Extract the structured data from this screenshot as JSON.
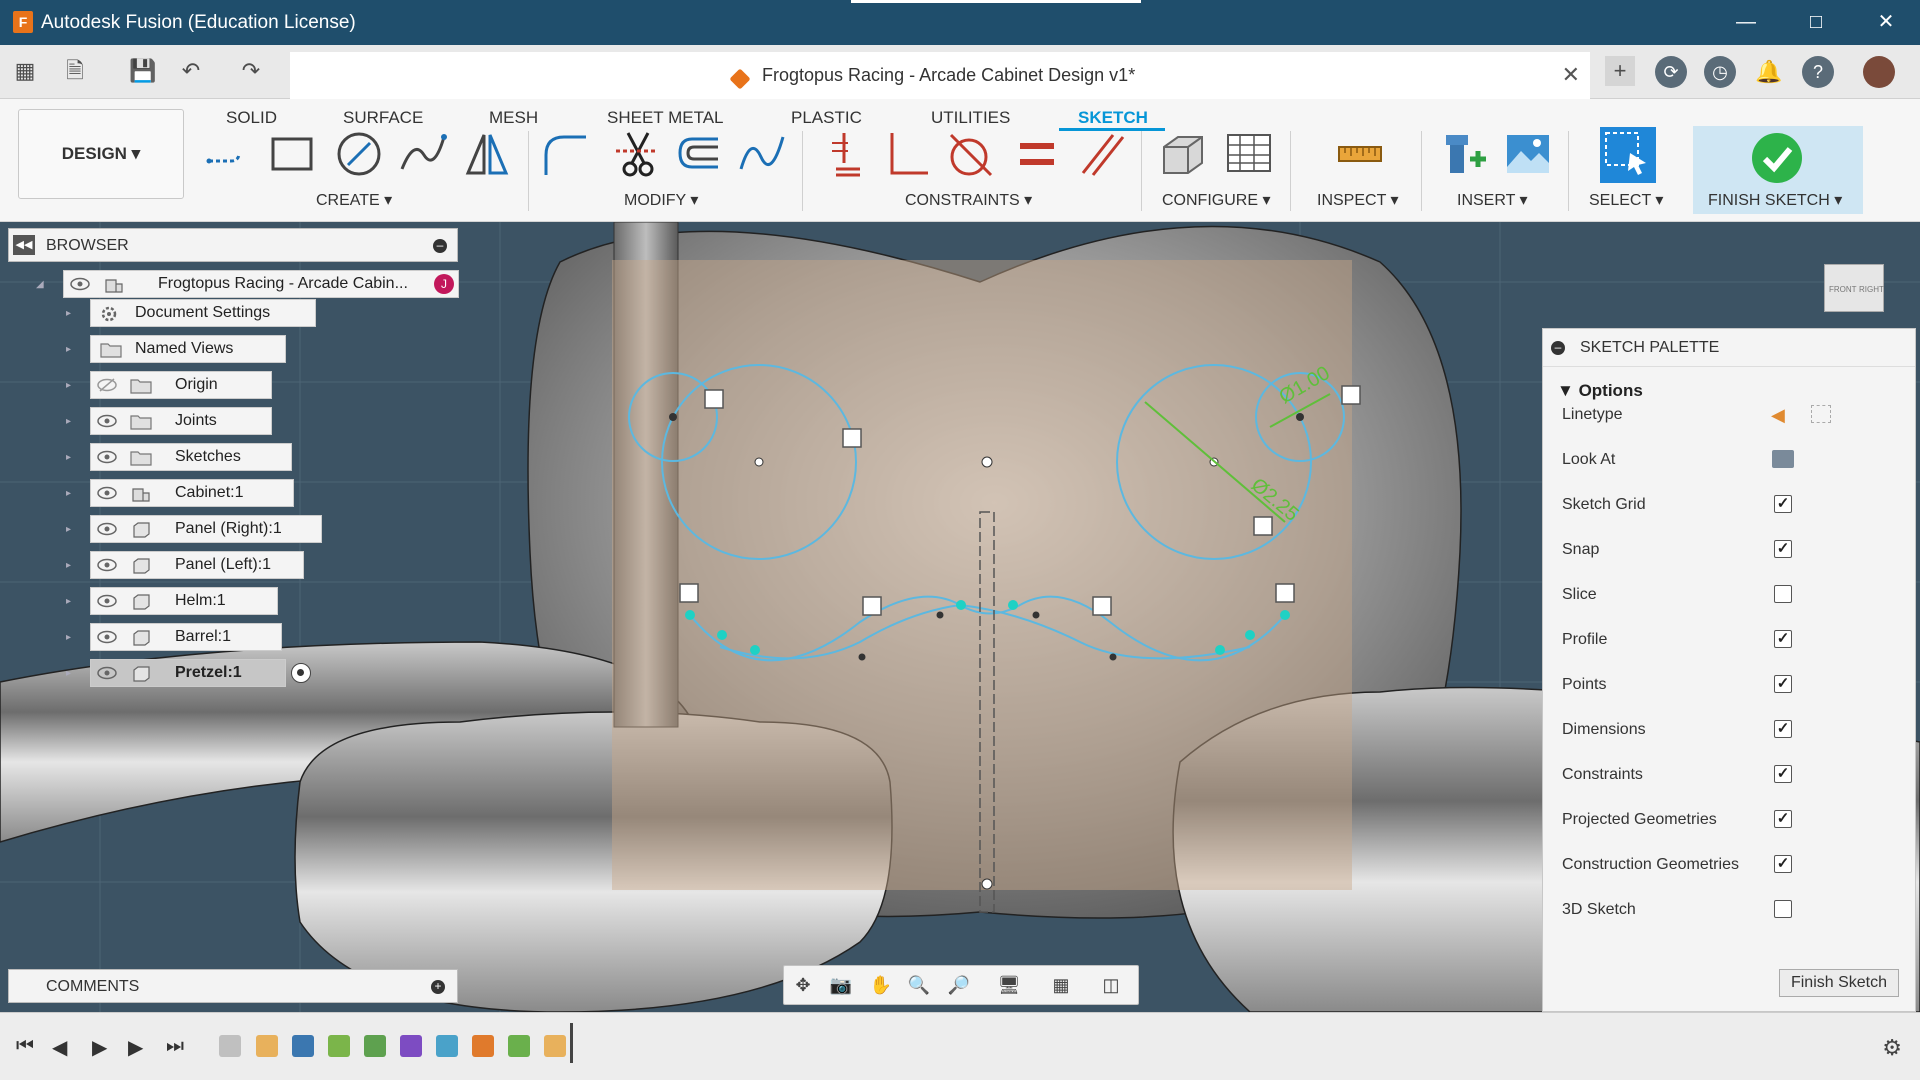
{
  "window": {
    "title": "Autodesk Fusion (Education License)",
    "app_icon": "F"
  },
  "document": {
    "title": "Frogtopus Racing - Arcade Cabinet Design v1*"
  },
  "ribbon": {
    "workspace": "DESIGN ▾",
    "tabs": [
      "SOLID",
      "SURFACE",
      "MESH",
      "SHEET METAL",
      "PLASTIC",
      "UTILITIES",
      "SKETCH"
    ],
    "active_tab": "SKETCH",
    "groups": {
      "create": "CREATE ▾",
      "modify": "MODIFY ▾",
      "constraints": "CONSTRAINTS ▾",
      "configure": "CONFIGURE ▾",
      "inspect": "INSPECT ▾",
      "insert": "INSERT ▾",
      "select": "SELECT ▾",
      "finish": "FINISH SKETCH ▾"
    }
  },
  "browser": {
    "title": "BROWSER",
    "root": "Frogtopus Racing - Arcade Cabin...",
    "items": [
      {
        "label": "Document Settings",
        "icon": "gear-icon"
      },
      {
        "label": "Named Views",
        "icon": "folder-icon"
      },
      {
        "label": "Origin",
        "icon": "folder-icon"
      },
      {
        "label": "Joints",
        "icon": "folder-icon"
      },
      {
        "label": "Sketches",
        "icon": "folder-icon"
      },
      {
        "label": "Cabinet:1",
        "icon": "component-icon"
      },
      {
        "label": "Panel (Right):1",
        "icon": "body-icon"
      },
      {
        "label": "Panel (Left):1",
        "icon": "body-icon"
      },
      {
        "label": "Helm:1",
        "icon": "body-icon"
      },
      {
        "label": "Barrel:1",
        "icon": "body-icon"
      },
      {
        "label": "Pretzel:1",
        "icon": "body-icon"
      }
    ]
  },
  "comments": {
    "title": "COMMENTS"
  },
  "sketch_palette": {
    "title": "SKETCH PALETTE",
    "section": "Options",
    "options": [
      {
        "label": "Linetype",
        "type": "icons"
      },
      {
        "label": "Look At",
        "type": "icon"
      },
      {
        "label": "Sketch Grid",
        "checked": true
      },
      {
        "label": "Snap",
        "checked": true
      },
      {
        "label": "Slice",
        "checked": false
      },
      {
        "label": "Profile",
        "checked": true
      },
      {
        "label": "Points",
        "checked": true
      },
      {
        "label": "Dimensions",
        "checked": true
      },
      {
        "label": "Constraints",
        "checked": true
      },
      {
        "label": "Projected Geometries",
        "checked": true
      },
      {
        "label": "Construction Geometries",
        "checked": true
      },
      {
        "label": "3D Sketch",
        "checked": false
      }
    ],
    "finish_button": "Finish Sketch"
  },
  "sketch": {
    "dim_left": "Ø1.00",
    "dim_right": "Ø2.25"
  },
  "viewcube": {
    "front": "FRONT",
    "right": "RIGHT"
  },
  "colors": {
    "titlebar": "#1f4e6c",
    "accent": "#0696d7",
    "sketch_line": "#5cb8e0",
    "dimension": "#5fbf3a"
  }
}
